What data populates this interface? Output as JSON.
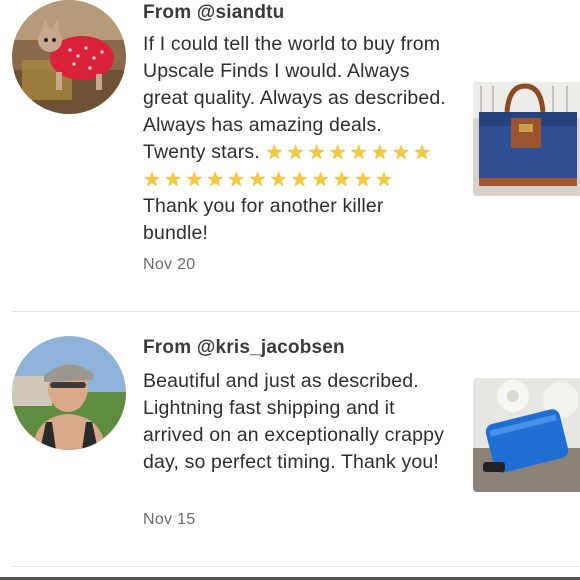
{
  "reviews": [
    {
      "from": "From @siandtu",
      "text_before_stars": "If I could tell the world to buy from Upscale Finds I would. Always great quality. Always as described. Always has amazing deals. Twenty stars.",
      "star_count": 20,
      "text_after_stars": "Thank you for another killer bundle!",
      "date": "Nov 20",
      "avatar_icon": "cat-in-red-sweater-photo",
      "thumbnail_icon": "blue-leather-tote-photo"
    },
    {
      "from": "From @kris_jacobsen",
      "text": "Beautiful and just as described. Lightning fast shipping and it arrived on an exceptionally crappy day, so perfect timing. Thank you!",
      "date": "Nov 15",
      "avatar_icon": "woman-with-cap-photo",
      "thumbnail_icon": "blue-wallet-photo"
    }
  ],
  "colors": {
    "star": "#f4c93b",
    "divider": "#e3e3e3",
    "date_text": "#6b6b6b"
  }
}
